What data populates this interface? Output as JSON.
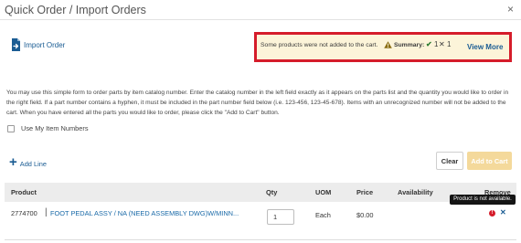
{
  "modal": {
    "title": "Quick Order / Import Orders",
    "close_glyph": "×"
  },
  "import": {
    "label": "Import Order",
    "icon": "file-import-icon"
  },
  "notice": {
    "message": "Some products were not added to the cart.",
    "summary_label": "Summary:",
    "success_glyph": "✔",
    "success_count": "1",
    "error_glyph": "✕",
    "error_count": "1",
    "view_more": "View More",
    "warning_icon": "warning-icon",
    "border_color": "#d51c2a",
    "background_color": "#fcf4d9"
  },
  "instructions": "You may use this simple form to order parts by item catalog number. Enter the catalog number in the left field exactly as it appears on the parts list and the quantity you would like to order in the right field. If a part number contains a hyphen, it must be included in the part number field below (i.e. 123-456, 123-45-678). Items with an unrecognized number will not be added to the cart. When you have entered all the parts you would like to order, please click the \"Add to Cart\" button.",
  "options": {
    "use_my_item_numbers_label": "Use My Item Numbers",
    "use_my_item_numbers_checked": false
  },
  "actions": {
    "add_line_label": "Add Line",
    "add_line_glyph": "+",
    "clear_label": "Clear",
    "add_to_cart_label": "Add to Cart",
    "add_to_cart_color": "#f4d99b"
  },
  "table": {
    "columns": [
      "Product",
      "Qty",
      "UOM",
      "Price",
      "Availability",
      "Remove"
    ],
    "rows": [
      {
        "part_number": "2774700",
        "separator": "|",
        "description": "FOOT PEDAL ASSY / NA (NEED ASSEMBLY DWG)W/MINN...",
        "qty": "1",
        "uom": "Each",
        "price": "$0.00",
        "availability": "",
        "error_glyph": "!",
        "remove_glyph": "✕"
      }
    ]
  },
  "tooltip": {
    "text": "Product is not available."
  }
}
